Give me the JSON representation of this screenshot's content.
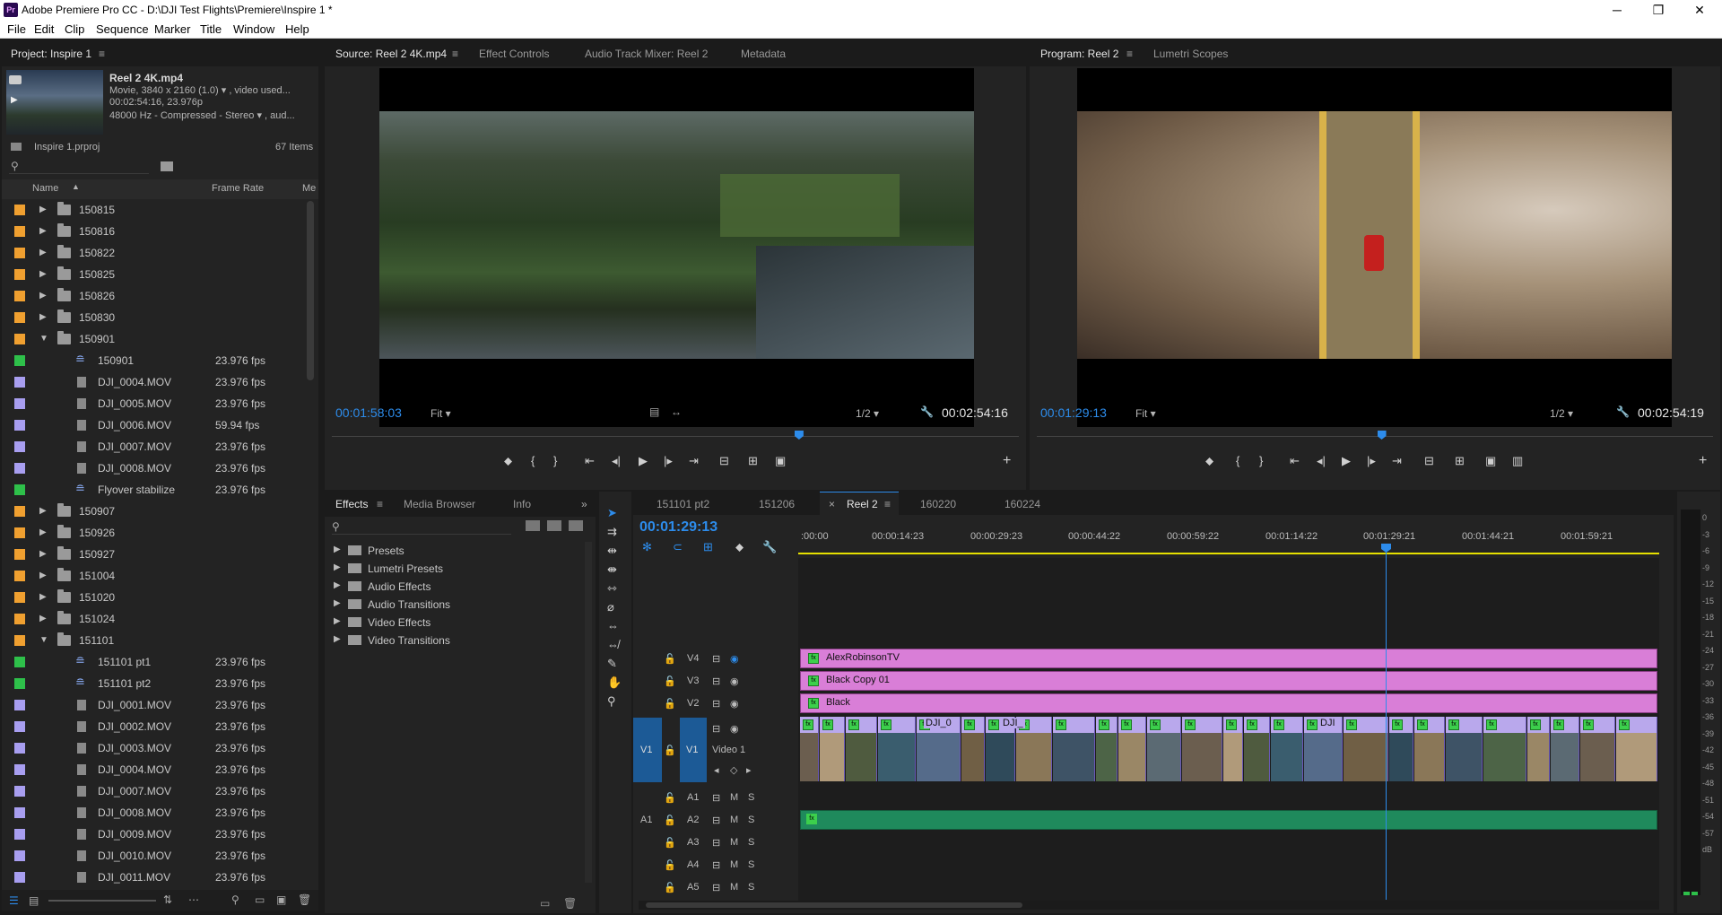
{
  "window": {
    "title": "Adobe Premiere Pro CC - D:\\DJI Test Flights\\Premiere\\Inspire 1 *",
    "logo": "Pr",
    "min": "─",
    "max": "❐",
    "close": "✕"
  },
  "menu": [
    "File",
    "Edit",
    "Clip",
    "Sequence",
    "Marker",
    "Title",
    "Window",
    "Help"
  ],
  "project": {
    "tab": "Project: Inspire 1",
    "menu_icon": "≡",
    "preview": {
      "name": "Reel 2 4K.mp4",
      "line1": "Movie, 3840 x 2160 (1.0) ▾ , video used...",
      "line2": "00:02:54:16, 23.976p",
      "line3": "48000 Hz - Compressed - Stereo ▾ , aud..."
    },
    "file": "Inspire 1.prproj",
    "count": "67 Items",
    "columns": {
      "name": "Name",
      "rate": "Frame Rate",
      "media": "Me"
    },
    "rows": [
      {
        "type": "folder",
        "name": "150815",
        "color": "#f0a030",
        "arrow": "▶"
      },
      {
        "type": "folder",
        "name": "150816",
        "color": "#f0a030",
        "arrow": "▶"
      },
      {
        "type": "folder",
        "name": "150822",
        "color": "#f0a030",
        "arrow": "▶"
      },
      {
        "type": "folder",
        "name": "150825",
        "color": "#f0a030",
        "arrow": "▶"
      },
      {
        "type": "folder",
        "name": "150826",
        "color": "#f0a030",
        "arrow": "▶"
      },
      {
        "type": "folder",
        "name": "150830",
        "color": "#f0a030",
        "arrow": "▶"
      },
      {
        "type": "folder",
        "name": "150901",
        "color": "#f0a030",
        "arrow": "▼"
      },
      {
        "type": "seq",
        "name": "150901",
        "fps": "23.976 fps",
        "color": "#2ec04a"
      },
      {
        "type": "clip",
        "name": "DJI_0004.MOV",
        "fps": "23.976 fps",
        "color": "#a89ef0"
      },
      {
        "type": "clip",
        "name": "DJI_0005.MOV",
        "fps": "23.976 fps",
        "color": "#a89ef0"
      },
      {
        "type": "clip",
        "name": "DJI_0006.MOV",
        "fps": "59.94 fps",
        "color": "#a89ef0"
      },
      {
        "type": "clip",
        "name": "DJI_0007.MOV",
        "fps": "23.976 fps",
        "color": "#a89ef0"
      },
      {
        "type": "clip",
        "name": "DJI_0008.MOV",
        "fps": "23.976 fps",
        "color": "#a89ef0"
      },
      {
        "type": "seq",
        "name": "Flyover stabilize",
        "fps": "23.976 fps",
        "color": "#2ec04a"
      },
      {
        "type": "folder",
        "name": "150907",
        "color": "#f0a030",
        "arrow": "▶"
      },
      {
        "type": "folder",
        "name": "150926",
        "color": "#f0a030",
        "arrow": "▶"
      },
      {
        "type": "folder",
        "name": "150927",
        "color": "#f0a030",
        "arrow": "▶"
      },
      {
        "type": "folder",
        "name": "151004",
        "color": "#f0a030",
        "arrow": "▶"
      },
      {
        "type": "folder",
        "name": "151020",
        "color": "#f0a030",
        "arrow": "▶"
      },
      {
        "type": "folder",
        "name": "151024",
        "color": "#f0a030",
        "arrow": "▶"
      },
      {
        "type": "folder",
        "name": "151101",
        "color": "#f0a030",
        "arrow": "▼"
      },
      {
        "type": "seq",
        "name": "151101 pt1",
        "fps": "23.976 fps",
        "color": "#2ec04a"
      },
      {
        "type": "seq",
        "name": "151101 pt2",
        "fps": "23.976 fps",
        "color": "#2ec04a"
      },
      {
        "type": "clip",
        "name": "DJI_0001.MOV",
        "fps": "23.976 fps",
        "color": "#a89ef0"
      },
      {
        "type": "clip",
        "name": "DJI_0002.MOV",
        "fps": "23.976 fps",
        "color": "#a89ef0"
      },
      {
        "type": "clip",
        "name": "DJI_0003.MOV",
        "fps": "23.976 fps",
        "color": "#a89ef0"
      },
      {
        "type": "clip",
        "name": "DJI_0004.MOV",
        "fps": "23.976 fps",
        "color": "#a89ef0"
      },
      {
        "type": "clip",
        "name": "DJI_0007.MOV",
        "fps": "23.976 fps",
        "color": "#a89ef0"
      },
      {
        "type": "clip",
        "name": "DJI_0008.MOV",
        "fps": "23.976 fps",
        "color": "#a89ef0"
      },
      {
        "type": "clip",
        "name": "DJI_0009.MOV",
        "fps": "23.976 fps",
        "color": "#a89ef0"
      },
      {
        "type": "clip",
        "name": "DJI_0010.MOV",
        "fps": "23.976 fps",
        "color": "#a89ef0"
      },
      {
        "type": "clip",
        "name": "DJI_0011.MOV",
        "fps": "23.976 fps",
        "color": "#a89ef0"
      }
    ]
  },
  "source": {
    "tabs": [
      "Source: Reel 2 4K.mp4",
      "Effect Controls",
      "Audio Track Mixer: Reel 2",
      "Metadata"
    ],
    "menu_icon": "≡",
    "timecode": "00:01:58:03",
    "fit": "Fit ▾",
    "resolution": "1/2 ▾",
    "duration": "00:02:54:16",
    "playhead_fraction": 0.68
  },
  "program": {
    "tabs": [
      "Program: Reel 2",
      "Lumetri Scopes"
    ],
    "menu_icon": "≡",
    "timecode": "00:01:29:13",
    "fit": "Fit ▾",
    "resolution": "1/2 ▾",
    "duration": "00:02:54:19",
    "playhead_fraction": 0.51
  },
  "effects": {
    "tabs": [
      "Effects",
      "Media Browser",
      "Info"
    ],
    "menu_icon": "≡",
    "more": "»",
    "bins": [
      "Presets",
      "Lumetri Presets",
      "Audio Effects",
      "Audio Transitions",
      "Video Effects",
      "Video Transitions"
    ]
  },
  "timeline": {
    "tabs": [
      "151101 pt2",
      "151206",
      "Reel 2",
      "160220",
      "160224"
    ],
    "close_icon": "×",
    "menu_icon": "≡",
    "timecode": "00:01:29:13",
    "ruler": [
      ":00:00",
      "00:00:14:23",
      "00:00:29:23",
      "00:00:44:22",
      "00:00:59:22",
      "00:01:14:22",
      "00:01:29:21",
      "00:01:44:21",
      "00:01:59:21"
    ],
    "video_tracks": [
      "V4",
      "V3",
      "V2",
      "V1"
    ],
    "v1_source": "V1",
    "track_name": "Video 1",
    "audio_tracks": [
      "A1",
      "A2",
      "A3",
      "A4",
      "A5"
    ],
    "a1_source": "A1",
    "clips": {
      "v4": "AlexRobinsonTV",
      "v3": "Black Copy 01",
      "v2": "Black",
      "v1a": "DJI_0",
      "v1b": "DJI_",
      "v1c": "DJI"
    },
    "ms": [
      "M",
      "S"
    ],
    "meter": [
      "0",
      "-3",
      "-6",
      "-9",
      "-12",
      "-15",
      "-18",
      "-21",
      "-24",
      "-27",
      "-30",
      "-33",
      "-36",
      "-39",
      "-42",
      "-45",
      "-48",
      "-51",
      "-54",
      "-57",
      "dB"
    ]
  },
  "colors": {
    "accent": "#2d8ceb",
    "folder": "#f0a030",
    "sequence": "#2ec04a",
    "clip": "#a89ef0",
    "graphic": "#d97ed7",
    "audio": "#1f8a5c"
  }
}
